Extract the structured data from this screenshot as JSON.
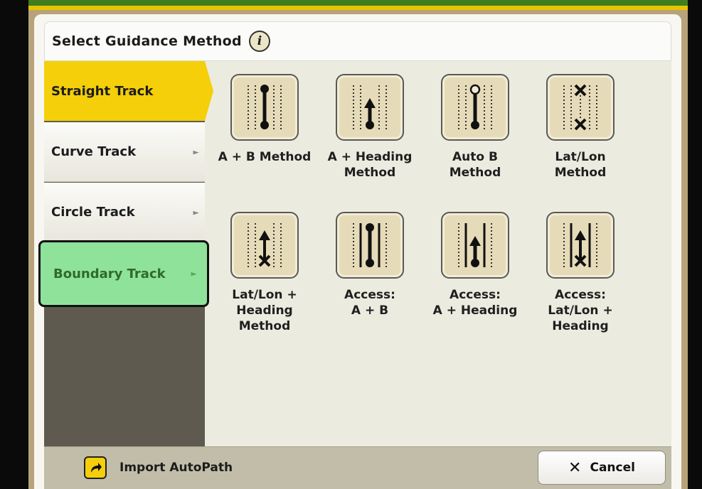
{
  "dialog": {
    "title": "Select Guidance Method",
    "info_glyph": "i"
  },
  "sidebar": {
    "items": [
      {
        "label": "Straight Track",
        "state": "selected"
      },
      {
        "label": "Curve Track",
        "arrow": "►"
      },
      {
        "label": "Circle Track",
        "arrow": "►"
      },
      {
        "label": "Boundary Track",
        "arrow": "►",
        "state": "highlighted"
      }
    ]
  },
  "methods": [
    {
      "label": "A + B Method",
      "icon": "ab-method-icon"
    },
    {
      "label": "A + Heading\nMethod",
      "icon": "a-heading-method-icon"
    },
    {
      "label": "Auto B\nMethod",
      "icon": "auto-b-method-icon"
    },
    {
      "label": "Lat/Lon\nMethod",
      "icon": "lat-lon-method-icon"
    },
    {
      "label": "Lat/Lon +\nHeading\nMethod",
      "icon": "lat-lon-heading-method-icon"
    },
    {
      "label": "Access:\nA + B",
      "icon": "access-ab-icon"
    },
    {
      "label": "Access:\nA + Heading",
      "icon": "access-a-heading-icon"
    },
    {
      "label": "Access:\nLat/Lon +\nHeading",
      "icon": "access-lat-lon-heading-icon"
    }
  ],
  "footer": {
    "import_label": "Import AutoPath",
    "cancel_label": "Cancel",
    "cancel_glyph": "✕"
  },
  "colors": {
    "selected": "#f4cf0a",
    "highlight": "#8fe29a",
    "tile": "#e6dbb8"
  }
}
